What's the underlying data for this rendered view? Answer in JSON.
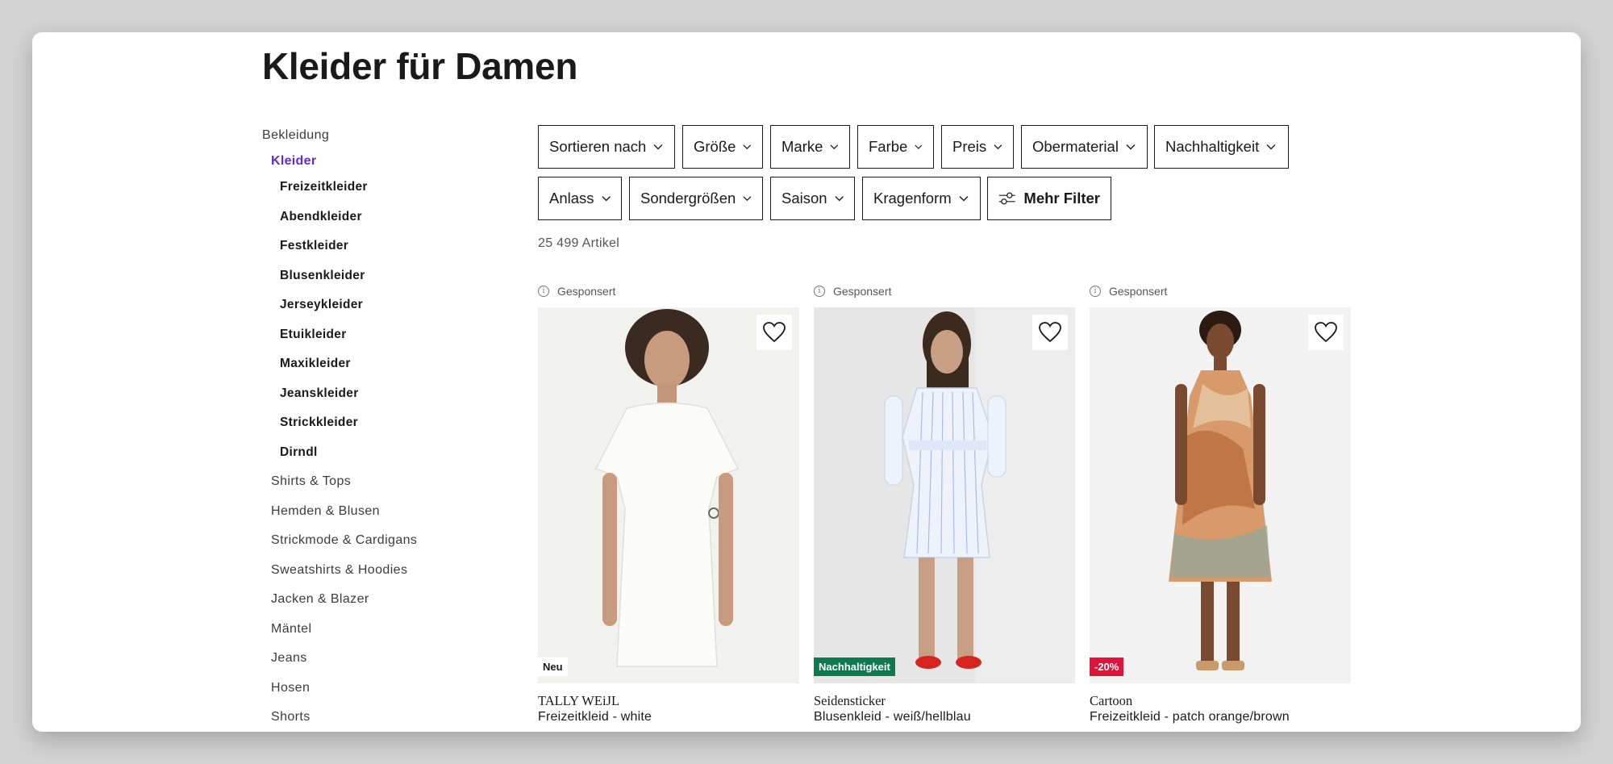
{
  "page_title": "Kleider für Damen",
  "sidebar": {
    "root": "Bekleidung",
    "active": "Kleider",
    "subcategories": [
      "Freizeitkleider",
      "Abendkleider",
      "Festkleider",
      "Blusenkleider",
      "Jerseykleider",
      "Etuikleider",
      "Maxikleider",
      "Jeanskleider",
      "Strickkleider",
      "Dirndl"
    ],
    "categories": [
      "Shirts & Tops",
      "Hemden & Blusen",
      "Strickmode & Cardigans",
      "Sweatshirts & Hoodies",
      "Jacken & Blazer",
      "Mäntel",
      "Jeans",
      "Hosen",
      "Shorts"
    ]
  },
  "filters": {
    "row1": [
      "Sortieren nach",
      "Größe",
      "Marke",
      "Farbe",
      "Preis",
      "Obermaterial",
      "Nachhaltigkeit"
    ],
    "row2": [
      "Anlass",
      "Sondergrößen",
      "Saison",
      "Kragenform"
    ],
    "more_label": "Mehr Filter"
  },
  "result_count": "25 499 Artikel",
  "products": [
    {
      "sponsored": "Gesponsert",
      "badge": "Neu",
      "badge_color": "#ffffff",
      "badge_text_color": "#1a1a1a",
      "brand": "TALLY WEiJL",
      "name": "Freizeitkleid - white"
    },
    {
      "sponsored": "Gesponsert",
      "badge": "Nachhaltigkeit",
      "badge_color": "#0b7a4f",
      "badge_text_color": "#ffffff",
      "brand": "Seidensticker",
      "name": "Blusenkleid - weiß/hellblau"
    },
    {
      "sponsored": "Gesponsert",
      "badge": "-20%",
      "badge_color": "#e0133a",
      "badge_text_color": "#ffffff",
      "brand": "Cartoon",
      "name": "Freizeitkleid - patch orange/brown"
    }
  ],
  "colors": {
    "accent": "#6328e0",
    "text": "#1a1a1a",
    "backdrop": "#d3d3d3"
  },
  "icons": {
    "chevron": "chevron-down-icon",
    "sliders": "sliders-icon",
    "heart": "heart-icon",
    "info": "info-icon"
  }
}
